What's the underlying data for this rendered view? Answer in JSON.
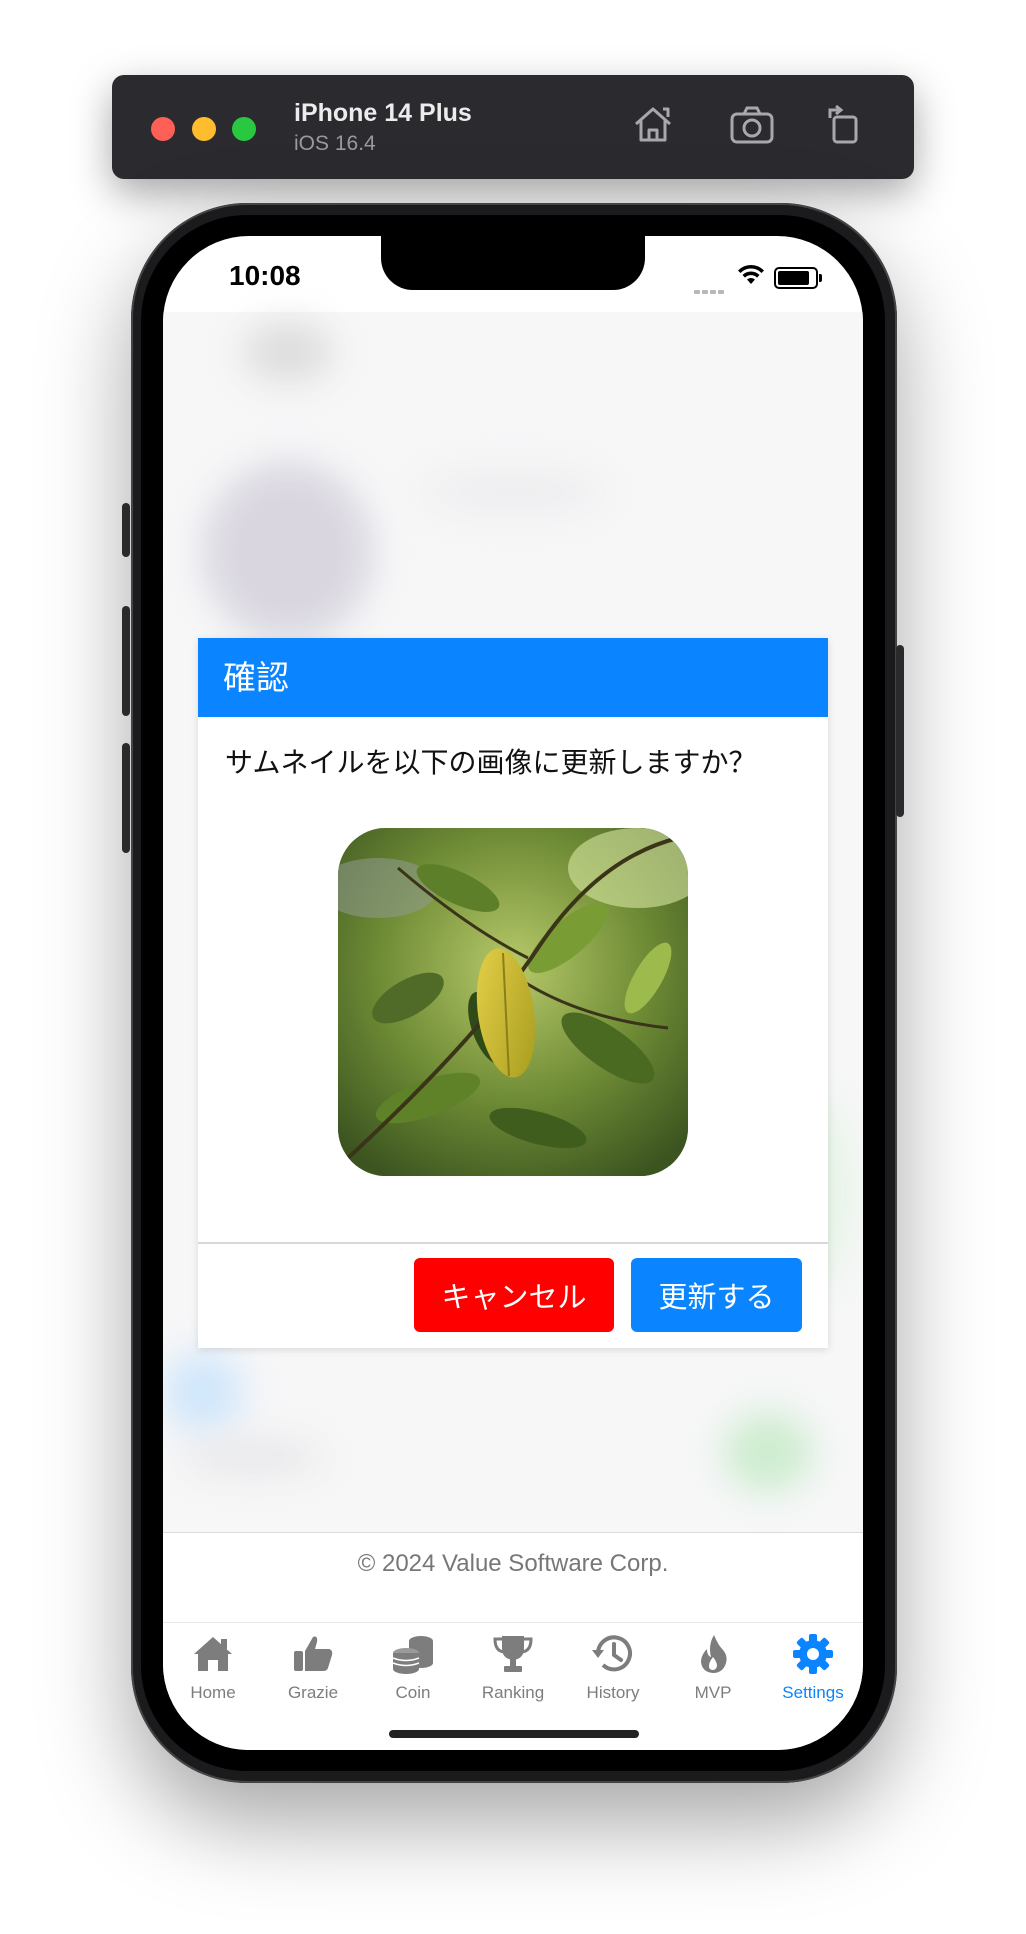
{
  "simulator": {
    "device_name": "iPhone 14 Plus",
    "os_version": "iOS 16.4",
    "toolbar_icons": [
      "home-icon",
      "screenshot-icon",
      "rotate-icon"
    ]
  },
  "status_bar": {
    "time": "10:08",
    "icons": [
      "signal-icon",
      "wifi-icon",
      "battery-icon"
    ]
  },
  "dialog": {
    "title": "確認",
    "message": "サムネイルを以下の画像に更新しますか？",
    "cancel_label": "キャンセル",
    "confirm_label": "更新する",
    "colors": {
      "header": "#0a84ff",
      "cancel": "#ff0000",
      "confirm": "#0a84ff"
    }
  },
  "footer": {
    "copyright": "© 2024 Value Software Corp."
  },
  "tabbar": {
    "active_color": "#0a84ff",
    "items": [
      {
        "label": "Home",
        "icon": "house-icon"
      },
      {
        "label": "Grazie",
        "icon": "thumbs-up-icon"
      },
      {
        "label": "Coin",
        "icon": "coins-icon"
      },
      {
        "label": "Ranking",
        "icon": "trophy-icon"
      },
      {
        "label": "History",
        "icon": "history-icon"
      },
      {
        "label": "MVP",
        "icon": "flame-icon"
      },
      {
        "label": "Settings",
        "icon": "gear-icon",
        "active": true
      }
    ]
  }
}
